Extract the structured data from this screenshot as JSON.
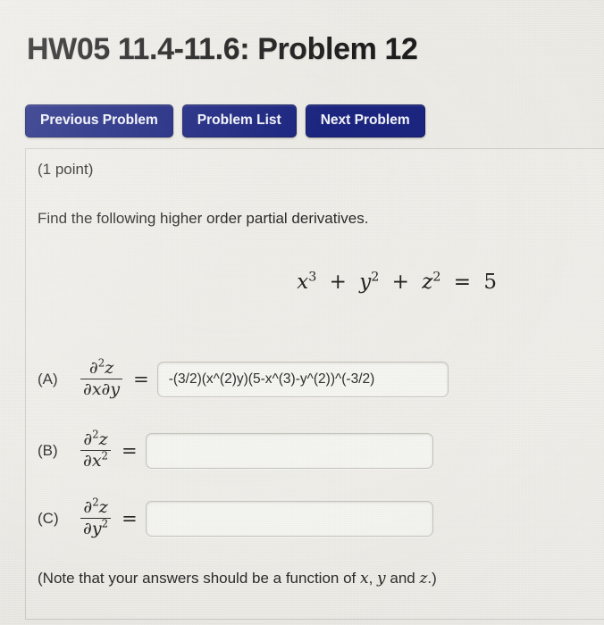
{
  "header": {
    "title": "HW05 11.4-11.6: Problem 12"
  },
  "nav": {
    "buttons": [
      {
        "label": "Previous Problem",
        "name": "previous-problem-button"
      },
      {
        "label": "Problem List",
        "name": "problem-list-button"
      },
      {
        "label": "Next Problem",
        "name": "next-problem-button"
      }
    ],
    "button_color": "#1b2580",
    "button_text_color": "#f3f4fb"
  },
  "problem": {
    "point_value": "(1 point)",
    "instruction": "Find the following higher order partial derivatives.",
    "equation": {
      "lhs_term_1_base": "x",
      "lhs_term_1_exp": "3",
      "plus_1": "+",
      "lhs_term_2_base": "y",
      "lhs_term_2_exp": "2",
      "plus_2": "+",
      "lhs_term_3_base": "z",
      "lhs_term_3_exp": "2",
      "equals": "=",
      "rhs": "5",
      "plain": "x^3 + y^2 + z^2 = 5"
    },
    "footnote_prefix": "(Note that your answers should be a function of ",
    "footnote_var_x": "x",
    "footnote_comma": ", ",
    "footnote_var_y": "y",
    "footnote_and": " and ",
    "footnote_var_z": "z",
    "footnote_suffix": ".)",
    "rows": [
      {
        "label": "(A)",
        "numerator_partial": "∂",
        "numerator_exp": "2",
        "numerator_var": "z",
        "denominator": "∂x∂y",
        "equals": "=",
        "value": "-(3/2)(x^(2)y)(5-x^(3)-y^(2))^(-3/2)",
        "placeholder": ""
      },
      {
        "label": "(B)",
        "numerator_partial": "∂",
        "numerator_exp": "2",
        "numerator_var": "z",
        "denominator_base": "∂x",
        "denominator_exp": "2",
        "equals": "=",
        "value": "",
        "placeholder": ""
      },
      {
        "label": "(C)",
        "numerator_partial": "∂",
        "numerator_exp": "2",
        "numerator_var": "z",
        "denominator_base": "∂y",
        "denominator_exp": "2",
        "equals": "=",
        "value": "",
        "placeholder": ""
      }
    ]
  },
  "theme": {
    "page_background": "#eeece7",
    "text_color": "#2a2a2a",
    "input_border": "#c6c4be"
  }
}
